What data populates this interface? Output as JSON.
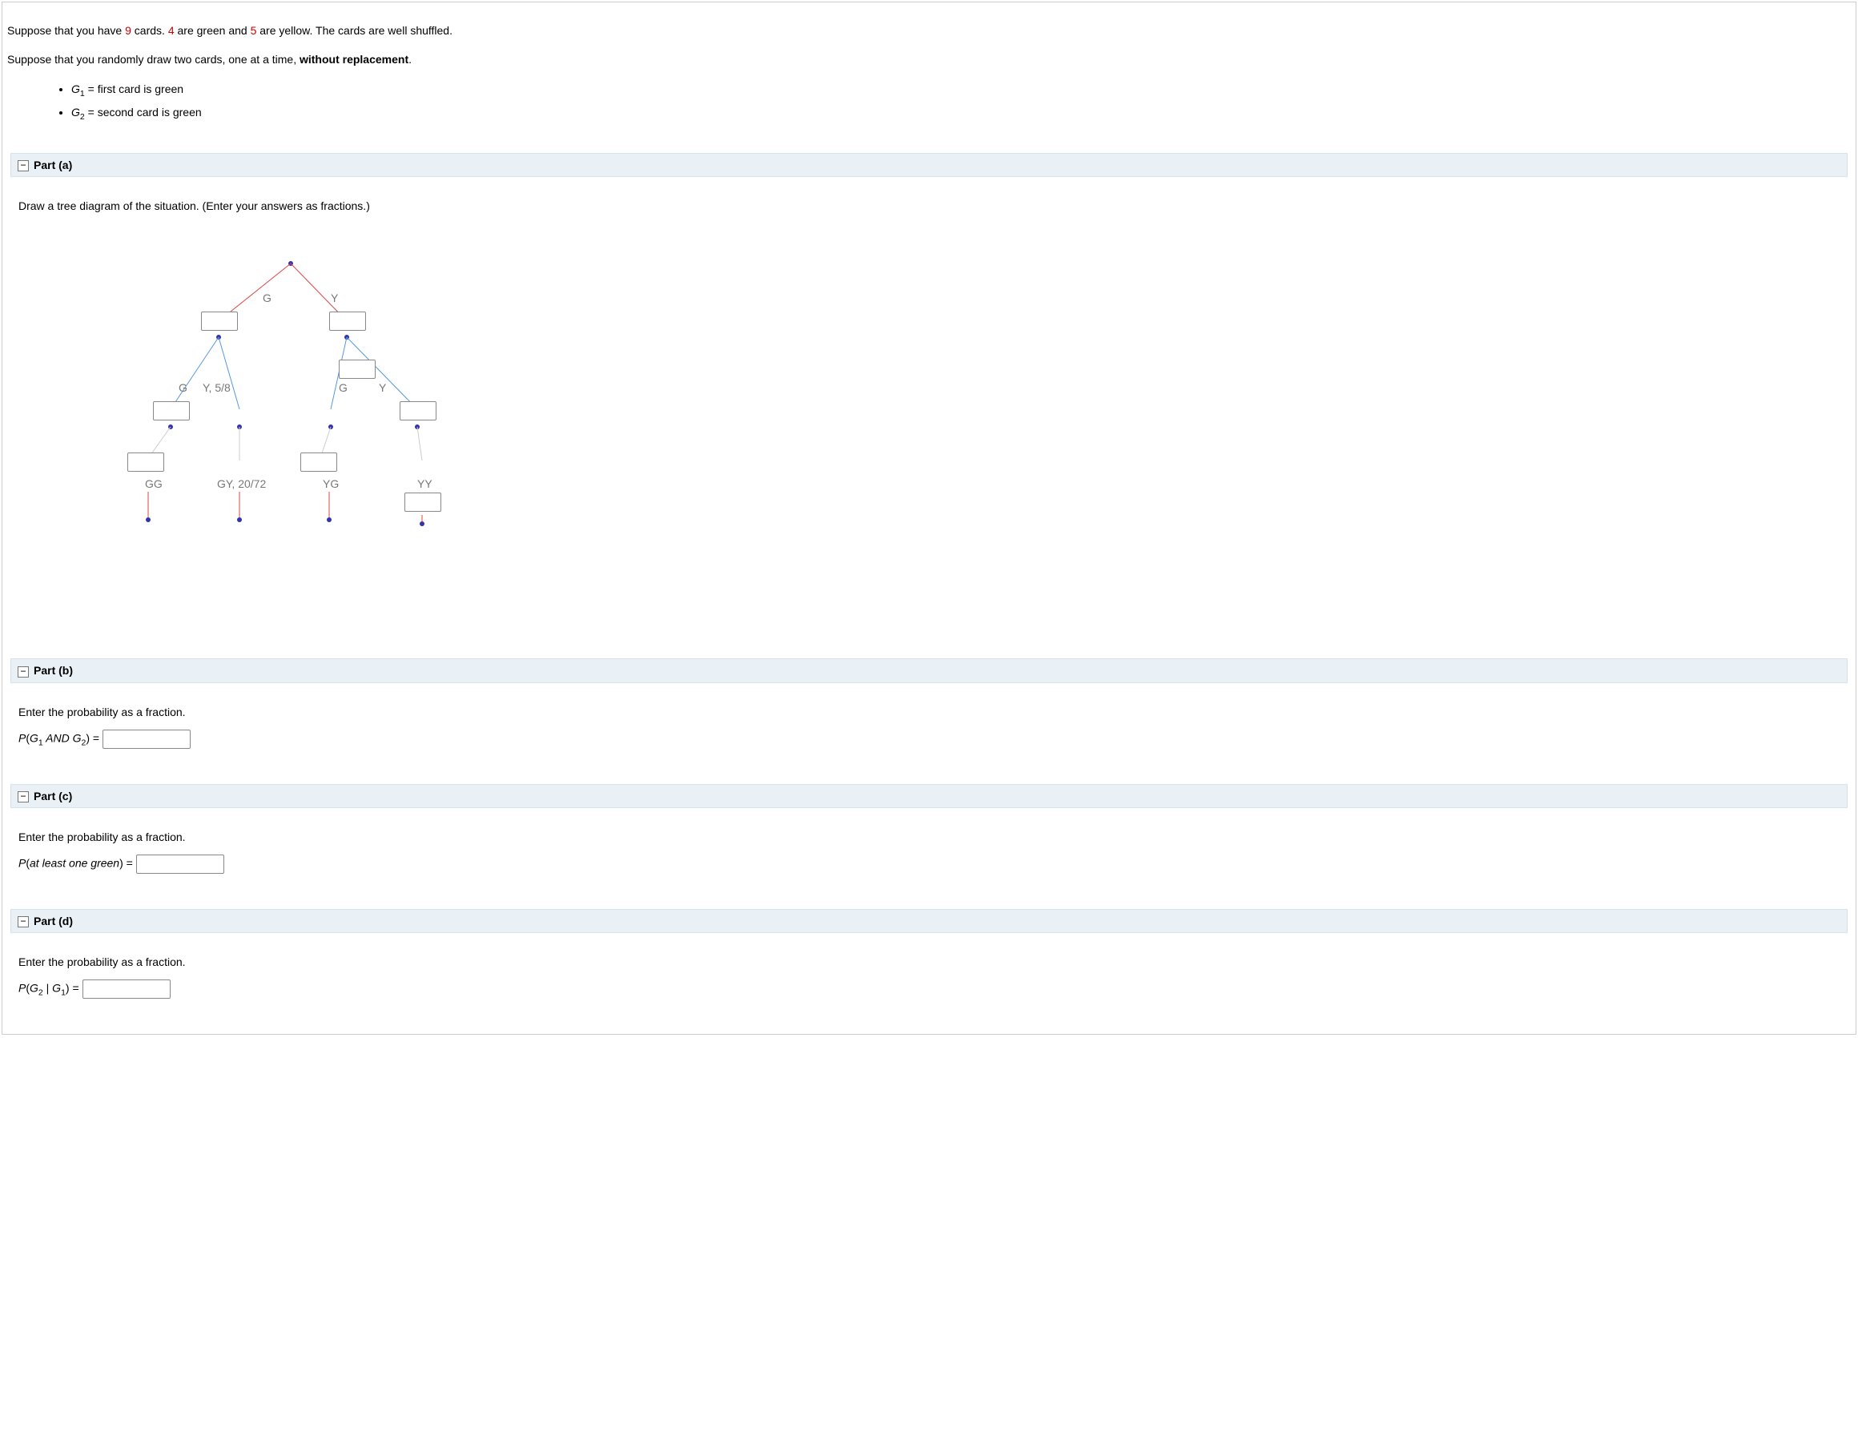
{
  "intro": {
    "line1_a": "Suppose that you have ",
    "line1_b": " cards. ",
    "line1_c": " are green and ",
    "line1_d": " are yellow. The cards are well shuffled.",
    "num_total": "9",
    "num_green": "4",
    "num_yellow": "5",
    "line2_a": "Suppose that you randomly draw two cards, one at a time, ",
    "line2_b": "without replacement",
    "line2_c": ".",
    "g1_label_pre": "G",
    "g1_sub": "1",
    "g1_after": " = first card is green",
    "g2_label_pre": "G",
    "g2_sub": "2",
    "g2_after": " = second card is green"
  },
  "parts": {
    "a": {
      "title": "Part (a)",
      "instr": "Draw a tree diagram of the situation. (Enter your answers as fractions.)"
    },
    "b": {
      "title": "Part (b)",
      "instr": "Enter the probability as a fraction.",
      "expr_pre": "P",
      "expr_open": "(",
      "expr_g1": "G",
      "expr_g1_sub": "1",
      "expr_and": " AND ",
      "expr_g2": "G",
      "expr_g2_sub": "2",
      "expr_close": ") = "
    },
    "c": {
      "title": "Part (c)",
      "instr": "Enter the probability as a fraction.",
      "expr_pre": "P",
      "expr_open": "(",
      "expr_text": "at least one green",
      "expr_close": ") = "
    },
    "d": {
      "title": "Part (d)",
      "instr": "Enter the probability as a fraction.",
      "expr_pre": "P",
      "expr_open": "(",
      "expr_g2": "G",
      "expr_g2_sub": "2",
      "expr_given": " | ",
      "expr_g1": "G",
      "expr_g1_sub": "1",
      "expr_close": ") = "
    }
  },
  "diagram": {
    "labels": {
      "topG": "G",
      "topY": "Y",
      "midGG": "G",
      "midGY": "Y, 5/8",
      "midYG": "G",
      "midYY": "Y",
      "outGG": "GG",
      "outGY": "GY, 20/72",
      "outYG": "YG",
      "outYY": "YY"
    }
  },
  "collapse_glyph": "−"
}
